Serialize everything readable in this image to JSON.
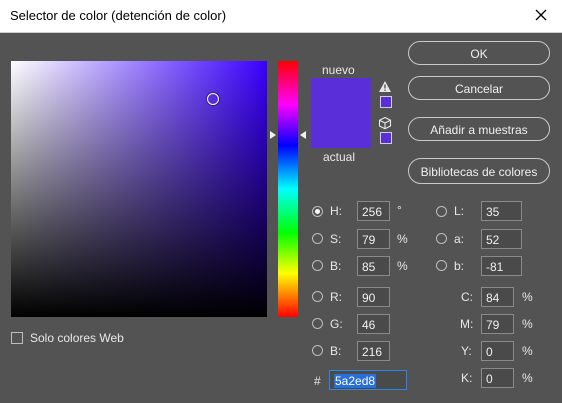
{
  "window": {
    "title": "Selector de color (detención de color)"
  },
  "colors": {
    "current": "#5a2ed8",
    "picker_hue_base": "#3a00ff"
  },
  "picker": {
    "cursor_saturation": 0.79,
    "cursor_brightness": 0.85,
    "hue_degrees": 256
  },
  "swatch": {
    "new_label": "nuevo",
    "current_label": "actual"
  },
  "buttons": {
    "ok": "OK",
    "cancel": "Cancelar",
    "add_to_swatches": "Añadir a muestras",
    "color_libraries": "Bibliotecas de colores"
  },
  "web_only": {
    "label": "Solo colores Web",
    "checked": false
  },
  "hsb": {
    "h": {
      "label": "H:",
      "value": "256",
      "unit": "°"
    },
    "s": {
      "label": "S:",
      "value": "79",
      "unit": "%"
    },
    "b": {
      "label": "B:",
      "value": "85",
      "unit": "%"
    }
  },
  "lab": {
    "l": {
      "label": "L:",
      "value": "35"
    },
    "a": {
      "label": "a:",
      "value": "52"
    },
    "b": {
      "label": "b:",
      "value": "-81"
    }
  },
  "rgb": {
    "r": {
      "label": "R:",
      "value": "90"
    },
    "g": {
      "label": "G:",
      "value": "46"
    },
    "b": {
      "label": "B:",
      "value": "216"
    }
  },
  "cmyk": {
    "c": {
      "label": "C:",
      "value": "84",
      "unit": "%"
    },
    "m": {
      "label": "M:",
      "value": "79",
      "unit": "%"
    },
    "y": {
      "label": "Y:",
      "value": "0",
      "unit": "%"
    },
    "k": {
      "label": "K:",
      "value": "0",
      "unit": "%"
    }
  },
  "hex": {
    "label": "#",
    "value": "5a2ed8"
  },
  "icons": {
    "close": "close-icon",
    "gamut_warning": "warning-triangle-icon",
    "web_safe": "cube-icon"
  }
}
